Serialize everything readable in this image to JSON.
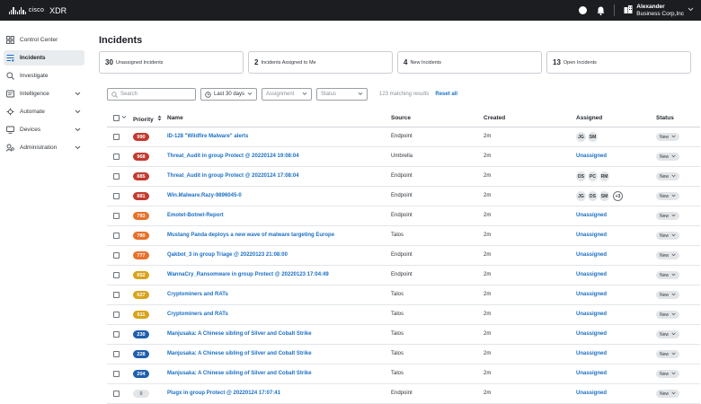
{
  "topbar": {
    "logo_text": "cisco",
    "app_title": "XDR",
    "user_name": "Alexander",
    "user_org": "Business Corp,Inc"
  },
  "sidebar": {
    "items": [
      {
        "label": "Control Center",
        "icon": "dashboard-icon"
      },
      {
        "label": "Incidents",
        "icon": "incidents-icon",
        "active": true
      },
      {
        "label": "Investigate",
        "icon": "search-icon"
      },
      {
        "label": "Intelligence",
        "icon": "intelligence-icon",
        "expandable": true
      },
      {
        "label": "Automate",
        "icon": "automate-icon",
        "expandable": true
      },
      {
        "label": "Devices",
        "icon": "devices-icon",
        "expandable": true
      },
      {
        "label": "Administration",
        "icon": "administration-icon",
        "expandable": true
      }
    ]
  },
  "page": {
    "title": "Incidents"
  },
  "summary_cards": [
    {
      "count": "30",
      "label": "Unassigned Incidents"
    },
    {
      "count": "2",
      "label": "Incidents Assigned to Me"
    },
    {
      "count": "4",
      "label": "New Incidents"
    },
    {
      "count": "13",
      "label": "Open Incidents"
    }
  ],
  "filters": {
    "search_placeholder": "Search",
    "date_range": "Last 30 days",
    "assignment_placeholder": "Assignment",
    "status_placeholder": "Status",
    "results_text": "123 matching results",
    "reset_label": "Reset all"
  },
  "table": {
    "columns": {
      "priority": "Priority",
      "name": "Name",
      "source": "Source",
      "created": "Created",
      "assigned": "Assigned",
      "status": "Status"
    },
    "rows": [
      {
        "priority": "990",
        "color": "#c23a2f",
        "name": "ID-128 \"Wildfire Malware\" alerts",
        "source": "Endpoint",
        "created": "2m",
        "assigned": [
          "JG",
          "SM"
        ],
        "status": "New"
      },
      {
        "priority": "968",
        "color": "#c23a2f",
        "name": "Threat_Audit in group Protect @ 20220124 19:08:04",
        "source": "Umbrella",
        "created": "2m",
        "assigned": "Unassigned",
        "status": "New"
      },
      {
        "priority": "885",
        "color": "#c23a2f",
        "name": "Threat_Audit in group Protect @ 20220124 17:08:04",
        "source": "Endpoint",
        "created": "2m",
        "assigned": [
          "DS",
          "PC",
          "RM"
        ],
        "status": "New"
      },
      {
        "priority": "881",
        "color": "#c23a2f",
        "name": "Win.Malware.Razy-9896045-0",
        "source": "Endpoint",
        "created": "2m",
        "assigned": [
          "JG",
          "DS",
          "SM"
        ],
        "assigned_more": "+3",
        "status": "New"
      },
      {
        "priority": "793",
        "color": "#e8702a",
        "name": "Emotet-Botnet-Report",
        "source": "Endpoint",
        "created": "2m",
        "assigned": "Unassigned",
        "status": "New"
      },
      {
        "priority": "780",
        "color": "#e8702a",
        "name": "Mustang Panda deploys a new wave of malware targeting Europe",
        "source": "Talos",
        "created": "2m",
        "assigned": "Unassigned",
        "status": "New"
      },
      {
        "priority": "777",
        "color": "#e8702a",
        "name": "Qakbot_3 in group Triage @ 20220123 21:08:00",
        "source": "Endpoint",
        "created": "2m",
        "assigned": "Unassigned",
        "status": "New"
      },
      {
        "priority": "652",
        "color": "#d9a21b",
        "name": "WannaCry_Ransomware in group Protect @ 20220123 17:04:49",
        "source": "Endpoint",
        "created": "2m",
        "assigned": "Unassigned",
        "status": "New"
      },
      {
        "priority": "627",
        "color": "#d9a21b",
        "name": "Cryptominers and RATs",
        "source": "Talos",
        "created": "2m",
        "assigned": "Unassigned",
        "status": "New"
      },
      {
        "priority": "611",
        "color": "#d9a21b",
        "name": "Cryptominers and RATs",
        "source": "Talos",
        "created": "2m",
        "assigned": "Unassigned",
        "status": "New"
      },
      {
        "priority": "230",
        "color": "#1f5fae",
        "name": "Manjusaka: A Chinese sibling of Silver and Cobalt Strike",
        "source": "Talos",
        "created": "2m",
        "assigned": "Unassigned",
        "status": "New"
      },
      {
        "priority": "228",
        "color": "#1f5fae",
        "name": "Manjusaka: A Chinese sibling of Silver and Cobalt Strike",
        "source": "Talos",
        "created": "2m",
        "assigned": "Unassigned",
        "status": "New"
      },
      {
        "priority": "204",
        "color": "#1f5fae",
        "name": "Manjusaka: A Chinese sibling of Silver and Cobalt Strike",
        "source": "Talos",
        "created": "2m",
        "assigned": "Unassigned",
        "status": "New"
      },
      {
        "priority": "0",
        "color": "#e2e5e8",
        "text_color": "#6c737a",
        "name": "Plugx in group Protect @ 20220124 17:07:41",
        "source": "Endpoint",
        "created": "2m",
        "assigned": "Unassigned",
        "status": "New"
      }
    ]
  }
}
